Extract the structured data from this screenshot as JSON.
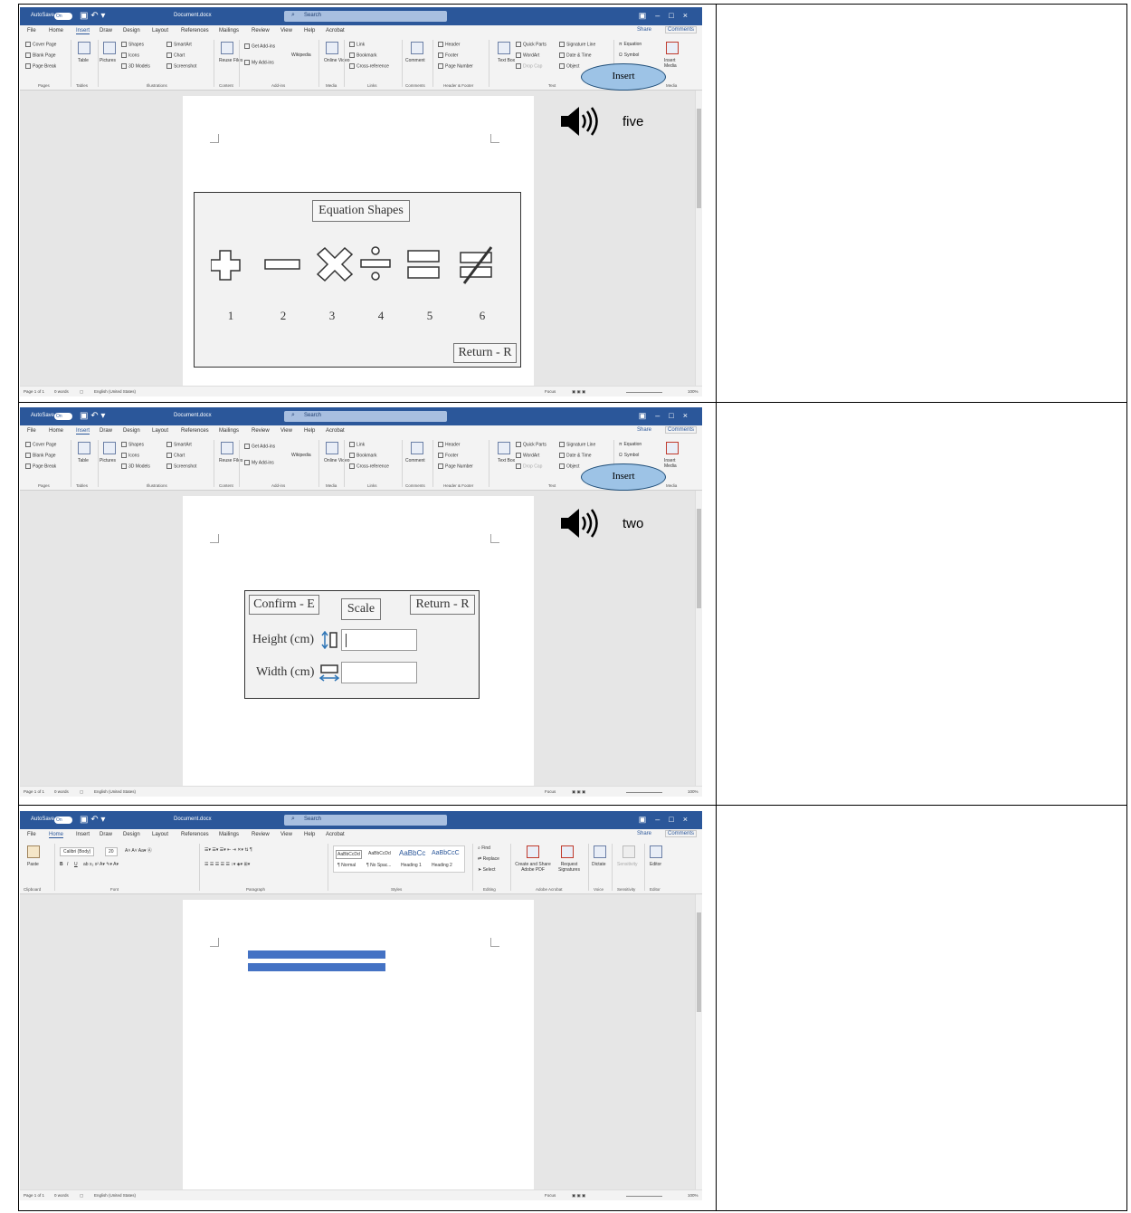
{
  "window": {
    "autosave_label": "AutoSave",
    "autosave_toggle": "On",
    "doc_title": "Document.docx",
    "search_placeholder": "Search",
    "share": "Share",
    "comments": "Comments"
  },
  "menu": [
    "File",
    "Home",
    "Insert",
    "Draw",
    "Design",
    "Layout",
    "References",
    "Mailings",
    "Review",
    "View",
    "Help",
    "Acrobat"
  ],
  "insert_ribbon": {
    "pages": [
      "Cover Page",
      "Blank Page",
      "Page Break"
    ],
    "pages_group": "Pages",
    "table": "Table",
    "tables_group": "Tables",
    "pictures": "Pictures",
    "illus_items": [
      "Shapes",
      "Icons",
      "3D Models",
      "SmartArt",
      "Chart",
      "Screenshot"
    ],
    "illus_group": "Illustrations",
    "reuse_files": "Reuse Files",
    "content_group": "Content",
    "addins_items": [
      "Get Add-ins",
      "My Add-ins",
      "Wikipedia"
    ],
    "addins_group": "Add-ins",
    "online_video": "Online Video",
    "media_group": "Media",
    "links_items": [
      "Link",
      "Bookmark",
      "Cross-reference"
    ],
    "links_group": "Links",
    "comment": "Comment",
    "comments_group": "Comments",
    "hf_items": [
      "Header",
      "Footer",
      "Page Number"
    ],
    "hf_group": "Header & Footer",
    "text_box": "Text Box",
    "text_items": [
      "Quick Parts",
      "WordArt",
      "Drop Cap",
      "Signature Line",
      "Date & Time",
      "Object"
    ],
    "text_group": "Text",
    "symbol_items": [
      "Equation",
      "Symbol"
    ],
    "insert_media": "Insert Media",
    "media2_group": "Media"
  },
  "home_ribbon": {
    "paste": "Paste",
    "clipboard_group": "Clipboard",
    "font_name": "Calibri (Body)",
    "font_size": "20",
    "font_group": "Font",
    "paragraph_group": "Paragraph",
    "styles": [
      "AaBbCcDd",
      "AaBbCcDd",
      "AaBbCc",
      "AaBbCcC"
    ],
    "style_names": [
      "¶ Normal",
      "¶ No Spac...",
      "Heading 1",
      "Heading 2"
    ],
    "styles_group": "Styles",
    "editing_items": [
      "Find",
      "Replace",
      "Select"
    ],
    "editing_group": "Editing",
    "acrobat_items": [
      "Create and Share Adobe PDF",
      "Request Signatures"
    ],
    "acrobat_group": "Adobe Acrobat",
    "dictate": "Dictate",
    "voice_group": "Voice",
    "sensitivity": "Sensitivity",
    "sensitivity_group": "Sensitivity",
    "editor": "Editor",
    "editor_group": "Editor"
  },
  "status": {
    "page": "Page 1 of 1",
    "words": "0 words",
    "language": "English (United States)",
    "focus": "Focus",
    "zoom": "100%"
  },
  "panel1": {
    "callout": "Insert",
    "spoken": "five",
    "dialog_title": "Equation Shapes",
    "numbers": [
      "1",
      "2",
      "3",
      "4",
      "5",
      "6"
    ],
    "return": "Return - R"
  },
  "panel2": {
    "callout": "Insert",
    "spoken": "two",
    "confirm": "Confirm - E",
    "scale": "Scale",
    "return": "Return - R",
    "height_label": "Height (cm)",
    "width_label": "Width (cm)"
  },
  "colors": {
    "titlebar": "#2b579a",
    "callout_fill": "#9dc3e6",
    "equal_shape": "#4472c4"
  }
}
